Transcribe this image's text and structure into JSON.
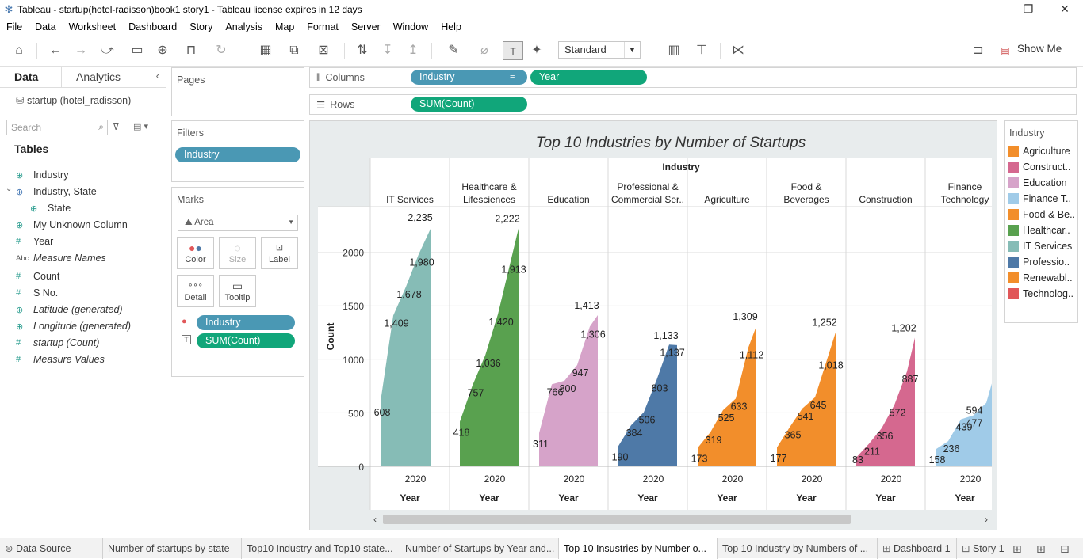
{
  "window": {
    "title": "Tableau - startup(hotel-radisson)book1 story1 - Tableau license expires in 12 days",
    "minimize": "—",
    "restore": "❐",
    "close": "✕"
  },
  "menu": [
    "File",
    "Data",
    "Worksheet",
    "Dashboard",
    "Story",
    "Analysis",
    "Map",
    "Format",
    "Server",
    "Window",
    "Help"
  ],
  "toolbar": {
    "fit": "Standard",
    "show_me": "Show Me"
  },
  "left_pane": {
    "tab_data": "Data",
    "tab_analytics": "Analytics",
    "datasource": "startup (hotel_radisson)",
    "search_placeholder": "Search",
    "tables_header": "Tables",
    "fields": [
      {
        "label": "Industry",
        "icon": "⊕",
        "type": "geo",
        "italic": false,
        "indent": 0
      },
      {
        "label": "Industry, State",
        "icon": "⊕",
        "type": "grp",
        "italic": false,
        "indent": 0
      },
      {
        "label": "State",
        "icon": "⊕",
        "type": "geo",
        "italic": false,
        "indent": 1
      },
      {
        "label": "My Unknown Column",
        "icon": "⊕",
        "type": "geo",
        "italic": false,
        "indent": 0
      },
      {
        "label": "Year",
        "icon": "#",
        "type": "num",
        "italic": false,
        "indent": 0
      },
      {
        "label": "Measure Names",
        "icon": "Abc",
        "type": "abc",
        "italic": true,
        "indent": 0
      },
      {
        "label": "Count",
        "icon": "#",
        "type": "num",
        "italic": false,
        "indent": 0
      },
      {
        "label": "S No.",
        "icon": "#",
        "type": "num",
        "italic": false,
        "indent": 0
      },
      {
        "label": "Latitude (generated)",
        "icon": "⊕",
        "type": "geo",
        "italic": true,
        "indent": 0
      },
      {
        "label": "Longitude (generated)",
        "icon": "⊕",
        "type": "geo",
        "italic": true,
        "indent": 0
      },
      {
        "label": "startup (Count)",
        "icon": "#",
        "type": "num",
        "italic": true,
        "indent": 0
      },
      {
        "label": "Measure Values",
        "icon": "#",
        "type": "num",
        "italic": true,
        "indent": 0
      }
    ]
  },
  "pages_title": "Pages",
  "filters_title": "Filters",
  "filters_pill": "Industry",
  "marks": {
    "title": "Marks",
    "type": "Area",
    "color": "Color",
    "size": "Size",
    "label": "Label",
    "detail": "Detail",
    "tooltip": "Tooltip",
    "pill_color": "Industry",
    "pill_label": "SUM(Count)"
  },
  "shelves": {
    "columns_label": "Columns",
    "rows_label": "Rows",
    "columns_pills": [
      "Industry",
      "Year"
    ],
    "rows_pill": "SUM(Count)"
  },
  "legend": {
    "title": "Industry",
    "items": [
      {
        "label": "Agriculture",
        "color": "#f28e2b"
      },
      {
        "label": "Construct..",
        "color": "#d5688f"
      },
      {
        "label": "Education",
        "color": "#d6a3c9"
      },
      {
        "label": "Finance T..",
        "color": "#a0cbe8"
      },
      {
        "label": "Food & Be..",
        "color": "#f28e2b"
      },
      {
        "label": "Healthcar..",
        "color": "#59a14f"
      },
      {
        "label": "IT Services",
        "color": "#86bcb6"
      },
      {
        "label": "Professio..",
        "color": "#4e79a7"
      },
      {
        "label": "Renewabl..",
        "color": "#f28e2b"
      },
      {
        "label": "Technolog..",
        "color": "#e15759"
      }
    ]
  },
  "chart_data": {
    "type": "area",
    "title": "Top 10 Industries by Number of Startups",
    "column_header": "Industry",
    "ylabel": "Count",
    "xlabel": "Year",
    "x_tick": "2020",
    "ylim": [
      0,
      2400
    ],
    "yticks": [
      0,
      500,
      1000,
      1500,
      2000
    ],
    "grid": true,
    "series": [
      {
        "name": "IT Services",
        "header": [
          "IT Services"
        ],
        "color": "#86bcb6",
        "values": [
          608,
          1409,
          1678,
          1980,
          2235
        ],
        "labels": [
          "608",
          "1,409",
          "1,678",
          "1,980",
          "2,235"
        ]
      },
      {
        "name": "Healthcare & Lifesciences",
        "header": [
          "Healthcare &",
          "Lifesciences"
        ],
        "color": "#59a14f",
        "values": [
          418,
          757,
          1036,
          1420,
          1913,
          2222
        ],
        "labels": [
          "418",
          "757",
          "1,036",
          "1,420",
          "1,913",
          "2,222"
        ]
      },
      {
        "name": "Education",
        "header": [
          "Education"
        ],
        "color": "#d6a3c9",
        "values": [
          311,
          766,
          800,
          947,
          1306,
          1413
        ],
        "labels": [
          "311",
          "766",
          "800",
          "947",
          "1,306",
          "1,413"
        ]
      },
      {
        "name": "Professional & Commercial Ser..",
        "header": [
          "Professional &",
          "Commercial Ser.."
        ],
        "color": "#4e79a7",
        "values": [
          190,
          384,
          506,
          803,
          1137,
          1133
        ],
        "labels": [
          "190",
          "384",
          "506",
          "803",
          "1,137",
          "1,133"
        ]
      },
      {
        "name": "Agriculture",
        "header": [
          "Agriculture"
        ],
        "color": "#f28e2b",
        "values": [
          173,
          319,
          525,
          633,
          1112,
          1309
        ],
        "labels": [
          "173",
          "319",
          "525",
          "633",
          "1,112",
          "1,309"
        ]
      },
      {
        "name": "Food & Beverages",
        "header": [
          "Food &",
          "Beverages"
        ],
        "color": "#f28e2b",
        "values": [
          177,
          365,
          541,
          645,
          1018,
          1252
        ],
        "labels": [
          "177",
          "365",
          "541",
          "645",
          "1,018",
          "1,252"
        ]
      },
      {
        "name": "Construction",
        "header": [
          "Construction"
        ],
        "color": "#d5688f",
        "values": [
          83,
          211,
          356,
          572,
          887,
          1202
        ],
        "labels": [
          "83",
          "211",
          "356",
          "572",
          "887",
          "1,202"
        ]
      },
      {
        "name": "Finance Technology",
        "header": [
          "Finance",
          "Technology"
        ],
        "color": "#a0cbe8",
        "values": [
          158,
          236,
          439,
          477,
          594,
          774
        ],
        "labels": [
          "158",
          "236",
          "439",
          "477",
          "594",
          "774"
        ]
      }
    ]
  },
  "bottom_tabs": [
    {
      "label": "Data Source",
      "active": false
    },
    {
      "label": "Number of startups by state",
      "active": false
    },
    {
      "label": "Top10 Industry and Top10 state...",
      "active": false
    },
    {
      "label": "Number of Startups by Year and...",
      "active": false
    },
    {
      "label": "Top 10 Insustries by Number o...",
      "active": true
    },
    {
      "label": "Top 10 Industry by Numbers of ...",
      "active": false
    },
    {
      "label": "Dashboard 1",
      "active": false
    },
    {
      "label": "Story 1",
      "active": false
    }
  ]
}
